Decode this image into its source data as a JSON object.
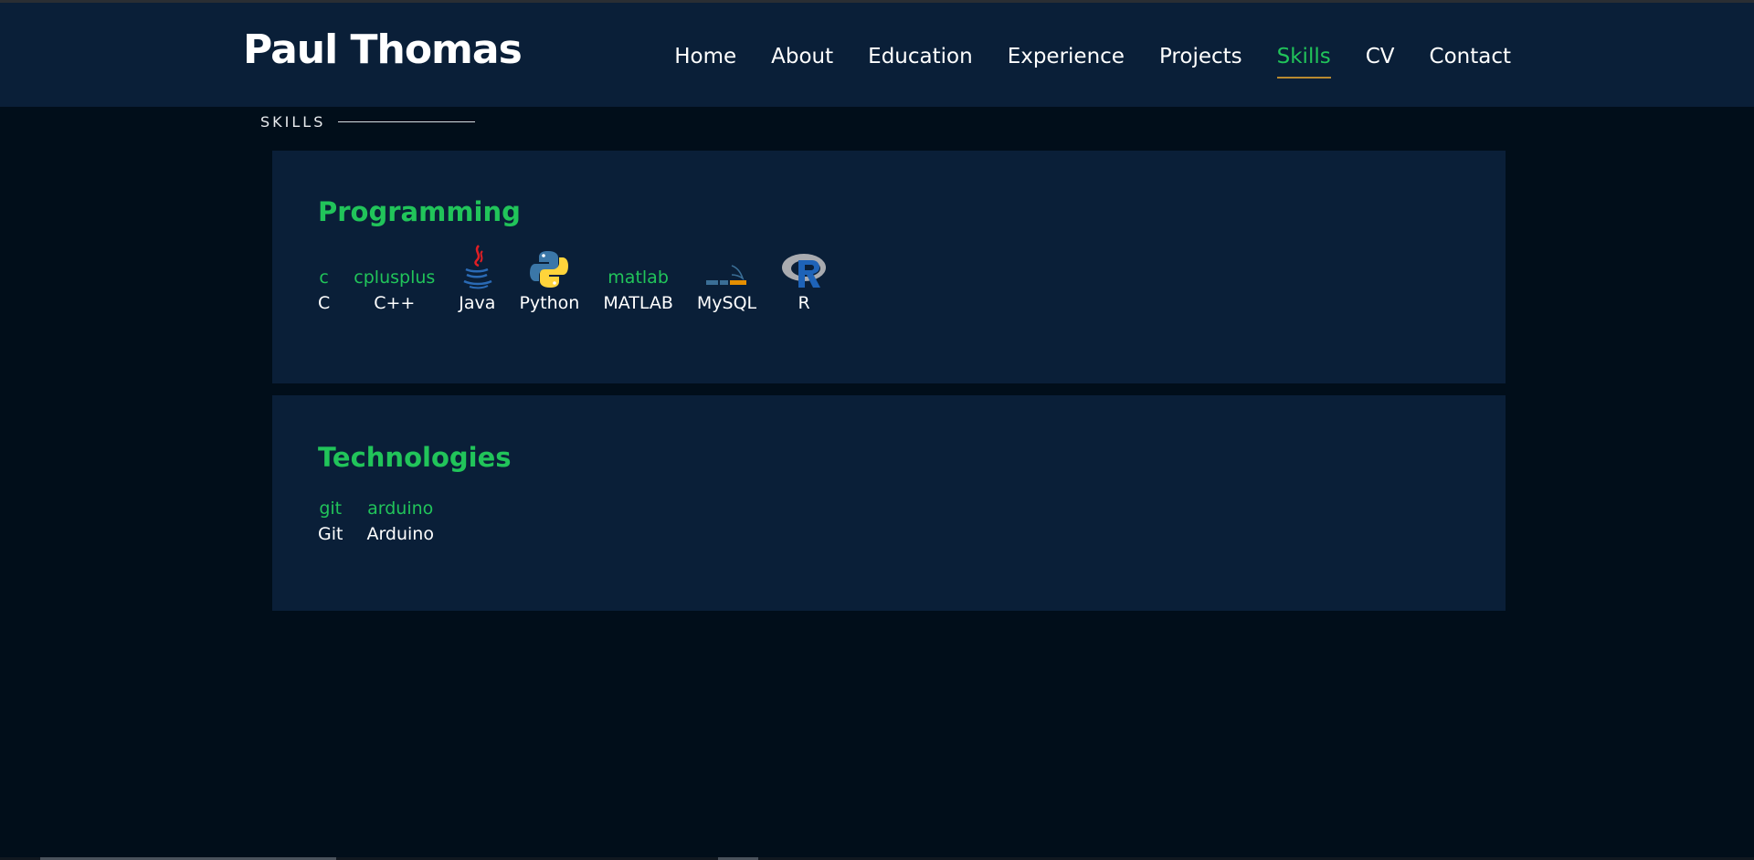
{
  "header": {
    "brand": "Paul Thomas",
    "nav": [
      {
        "label": "Home",
        "active": false
      },
      {
        "label": "About",
        "active": false
      },
      {
        "label": "Education",
        "active": false
      },
      {
        "label": "Experience",
        "active": false
      },
      {
        "label": "Projects",
        "active": false
      },
      {
        "label": "Skills",
        "active": true
      },
      {
        "label": "CV",
        "active": false
      },
      {
        "label": "Contact",
        "active": false
      }
    ]
  },
  "section": {
    "label": "SKILLS"
  },
  "programming": {
    "title": "Programming",
    "items": [
      {
        "alt": "c",
        "name": "C",
        "icon": null
      },
      {
        "alt": "cplusplus",
        "name": "C++",
        "icon": null
      },
      {
        "alt": "",
        "name": "Java",
        "icon": "java-logo-icon"
      },
      {
        "alt": "",
        "name": "Python",
        "icon": "python-logo-icon"
      },
      {
        "alt": "matlab",
        "name": "MATLAB",
        "icon": null
      },
      {
        "alt": "",
        "name": "MySQL",
        "icon": "mysql-logo-icon"
      },
      {
        "alt": "",
        "name": "R",
        "icon": "r-logo-icon"
      }
    ]
  },
  "technologies": {
    "title": "Technologies",
    "items": [
      {
        "alt": "git",
        "name": "Git"
      },
      {
        "alt": "arduino",
        "name": "Arduino"
      }
    ]
  },
  "colors": {
    "accent": "#21c45a",
    "background": "#010e1a",
    "panel": "#0a1f38",
    "underline": "#b88a30"
  }
}
